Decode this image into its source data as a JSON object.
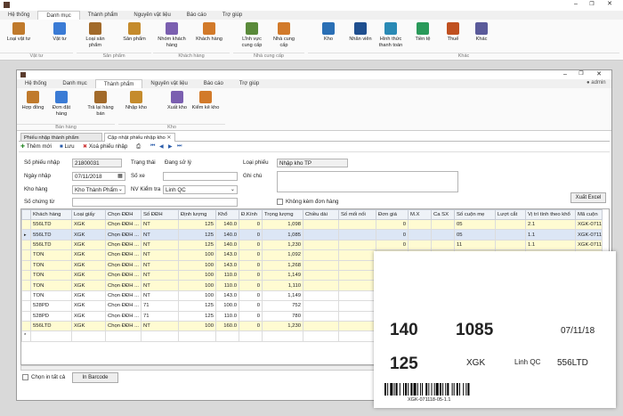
{
  "app_logo": "app-logo",
  "outer": {
    "tabs": [
      "Hệ thống",
      "Danh mục",
      "Thành phẩm",
      "Nguyên vật liệu",
      "Báo cáo",
      "Trợ giúp"
    ],
    "active_tab": 1,
    "buttons": [
      {
        "label": "Loại vật tư",
        "icon": "material-type-icon"
      },
      {
        "label": "Vật tư",
        "icon": "material-icon"
      },
      {
        "label": "Loại sản phẩm",
        "icon": "product-type-icon"
      },
      {
        "label": "Sản phẩm",
        "icon": "product-icon"
      },
      {
        "label": "Nhóm khách hàng",
        "icon": "customer-group-icon"
      },
      {
        "label": "Khách hàng",
        "icon": "customer-icon"
      },
      {
        "label": "Lĩnh vực cung cấp",
        "icon": "supply-field-icon"
      },
      {
        "label": "Nhà cung cấp",
        "icon": "supplier-icon"
      },
      {
        "label": "Kho",
        "icon": "warehouse-icon"
      },
      {
        "label": "Nhân viên",
        "icon": "employee-icon"
      },
      {
        "label": "Hình thức thanh toán",
        "icon": "payment-method-icon"
      },
      {
        "label": "Tiền tệ",
        "icon": "currency-icon"
      },
      {
        "label": "Thuế",
        "icon": "tax-icon"
      },
      {
        "label": "Khác",
        "icon": "other-icon"
      }
    ],
    "groups": [
      "Vật tư",
      "Sản phẩm",
      "Khách hàng",
      "Nhà cung cấp",
      "Khác"
    ]
  },
  "inner": {
    "tabs": [
      "Hệ thống",
      "Danh mục",
      "Thành phẩm",
      "Nguyên vật liệu",
      "Báo cáo",
      "Trợ giúp"
    ],
    "active_tab": 2,
    "user": "admin",
    "buttons": [
      {
        "label": "Hợp đồng",
        "icon": "contract-icon"
      },
      {
        "label": "Đơn đặt hàng",
        "icon": "order-icon"
      },
      {
        "label": "Trả lại hàng bán",
        "icon": "sales-return-icon"
      },
      {
        "label": "Nhập kho",
        "icon": "stock-in-icon"
      },
      {
        "label": "Xuất kho",
        "icon": "stock-out-icon"
      },
      {
        "label": "Kiểm kê kho",
        "icon": "inventory-check-icon"
      }
    ],
    "groups": [
      "Bán hàng",
      "Kho"
    ]
  },
  "doc_tabs": [
    "Phiếu nhập thành phẩm",
    "Cập nhật phiếu nhập kho"
  ],
  "toolbar": {
    "new": "Thêm mới",
    "save": "Lưu",
    "delete": "Xoá phiếu nhập"
  },
  "form": {
    "so_phieu_nhap": {
      "label": "Số phiếu nhập",
      "value": "21800031"
    },
    "trang_thai": {
      "label": "Trạng thái",
      "value": "Đang sử lý"
    },
    "loai_phieu": {
      "label": "Loại phiếu",
      "value": "Nhập kho TP"
    },
    "ngay_nhap": {
      "label": "Ngày nhập",
      "value": "07/11/2018"
    },
    "so_xe": {
      "label": "Số xe",
      "value": ""
    },
    "ghi_chu": {
      "label": "Ghi chú",
      "value": ""
    },
    "kho_hang": {
      "label": "Kho hàng",
      "value": "Kho Thành Phẩm"
    },
    "nv_kiem_tra": {
      "label": "NV Kiểm tra",
      "value": "Linh QC"
    },
    "so_chung_tu": {
      "label": "Số chứng từ",
      "value": ""
    },
    "khong_kem": "Không kèm đơn hàng",
    "xuat_excel": "Xuất Excel"
  },
  "table": {
    "headers": [
      "Khách hàng",
      "Loại giấy",
      "Chọn ĐĐH",
      "Số ĐĐH",
      "Định lượng",
      "Khổ",
      "Đ.Kính",
      "Trọng lượng",
      "Chiều dài",
      "Số mối nối",
      "Đơn giá",
      "M.X",
      "Ca SX",
      "Số cuộn mẹ",
      "Lượt cắt",
      "Vị trí tính theo khổ",
      "Mã cuộn"
    ],
    "rows": [
      [
        "556LTD",
        "XGK",
        "Chọn ĐĐH ...",
        "NT",
        "125",
        "140.0",
        "0",
        "1,098",
        "",
        "",
        "0",
        "",
        "",
        "05",
        "",
        "2.1",
        "XGK-0711"
      ],
      [
        "556LTD",
        "XGK",
        "Chọn ĐĐH ...",
        "NT",
        "125",
        "140.0",
        "0",
        "1,085",
        "",
        "",
        "0",
        "",
        "",
        "05",
        "",
        "1.1",
        "XGK-0711"
      ],
      [
        "556LTD",
        "XGK",
        "Chọn ĐĐH ...",
        "NT",
        "125",
        "140.0",
        "0",
        "1,230",
        "",
        "",
        "0",
        "",
        "",
        "11",
        "",
        "1.1",
        "XGK-0711"
      ],
      [
        "TON",
        "XGK",
        "Chọn ĐĐH ...",
        "NT",
        "100",
        "143.0",
        "0",
        "1,092",
        "",
        "",
        "",
        "",
        "",
        "",
        "",
        "",
        ""
      ],
      [
        "TON",
        "XGK",
        "Chọn ĐĐH ...",
        "NT",
        "100",
        "143.0",
        "0",
        "1,268",
        "",
        "",
        "",
        "",
        "",
        "",
        "",
        "",
        ""
      ],
      [
        "TON",
        "XGK",
        "Chọn ĐĐH ...",
        "NT",
        "100",
        "110.0",
        "0",
        "1,149",
        "",
        "",
        "",
        "",
        "",
        "",
        "",
        "",
        ""
      ],
      [
        "TON",
        "XGK",
        "Chọn ĐĐH ...",
        "NT",
        "100",
        "110.0",
        "0",
        "1,110",
        "",
        "",
        "",
        "",
        "",
        "",
        "",
        "",
        ""
      ],
      [
        "TON",
        "XGK",
        "Chọn ĐĐH ...",
        "NT",
        "100",
        "143.0",
        "0",
        "1,149",
        "",
        "",
        "",
        "",
        "",
        "",
        "",
        "",
        ""
      ],
      [
        "528PD",
        "XGK",
        "Chọn ĐĐH ...",
        "71",
        "125",
        "100.0",
        "0",
        "752",
        "",
        "",
        "",
        "",
        "",
        "",
        "",
        "",
        ""
      ],
      [
        "528PD",
        "XGK",
        "Chọn ĐĐH ...",
        "71",
        "125",
        "110.0",
        "0",
        "780",
        "",
        "",
        "",
        "",
        "",
        "",
        "",
        "",
        ""
      ],
      [
        "556LTD",
        "XGK",
        "Chọn ĐĐH ...",
        "NT",
        "100",
        "160.0",
        "0",
        "1,230",
        "",
        "",
        "",
        "",
        "",
        "",
        "",
        "",
        ""
      ]
    ]
  },
  "footer": {
    "chon_in": "Chọn in tất cả",
    "in_barcode": "In Barcode"
  },
  "label_card": {
    "a": "140",
    "b": "1085",
    "date": "07/11/18",
    "c": "125",
    "paper": "XGK",
    "inspector": "Linh QC",
    "customer": "556LTD",
    "barcode": "XGK-071118-05-1.1"
  }
}
